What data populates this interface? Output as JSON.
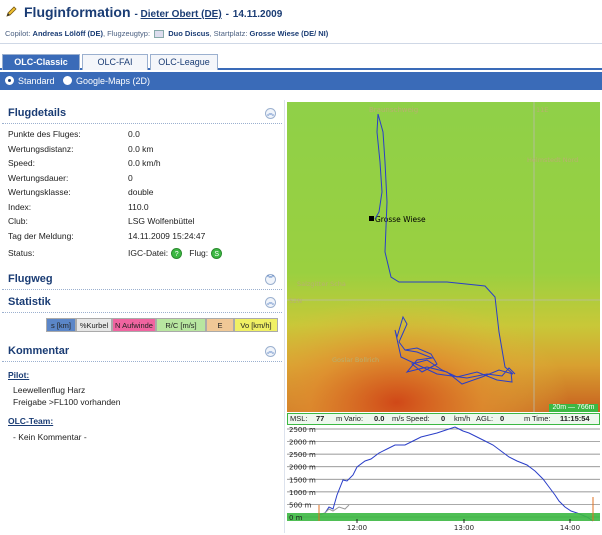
{
  "header": {
    "title": "Fluginformation",
    "pilot": "Dieter Obert (DE)",
    "separator": "-",
    "date": "14.11.2009",
    "copilot_label": "Copilot:",
    "copilot": "Andreas Lölöff (DE)",
    "plane_label": ", Flugzeugtyp:",
    "plane": "Duo Discus",
    "start_label": ", Startplatz:",
    "start": "Grosse Wiese (DE/ NI)"
  },
  "tabs": [
    {
      "label": "OLC-Classic",
      "active": true
    },
    {
      "label": "OLC-FAI",
      "active": false
    },
    {
      "label": "OLC-League",
      "active": false
    }
  ],
  "mode": {
    "standard": "Standard",
    "gmaps": "Google-Maps (2D)",
    "selected": "Standard"
  },
  "flugdetails": {
    "title": "Flugdetails",
    "rows": [
      {
        "k": "Punkte des Fluges:",
        "v": "0.0"
      },
      {
        "k": "Wertungsdistanz:",
        "v": "0.0 km"
      },
      {
        "k": "Speed:",
        "v": "0.0 km/h"
      },
      {
        "k": "Wertungsdauer:",
        "v": "0"
      },
      {
        "k": "Wertungsklasse:",
        "v": "double"
      },
      {
        "k": "Index:",
        "v": "110.0"
      },
      {
        "k": "Club:",
        "v": "LSG Wolfenbüttel"
      },
      {
        "k": "Tag der Meldung:",
        "v": "14.11.2009 15:24:47"
      }
    ],
    "status_label": "Status:",
    "igc_label": "IGC-Datei:",
    "flug_label": "Flug:",
    "igc_mark": "?",
    "flug_mark": "S"
  },
  "flugweg": {
    "title": "Flugweg"
  },
  "statistik": {
    "title": "Statistik",
    "buttons": [
      {
        "label": "s [km]",
        "color": "#5b86c8"
      },
      {
        "label": "%Kurbel",
        "color": "#e6e6e6"
      },
      {
        "label": "N Aufwinde",
        "color": "#f064a0"
      },
      {
        "label": "R/C [m/s]",
        "color": "#b8e6a0"
      },
      {
        "label": "E",
        "color": "#f0c896"
      },
      {
        "label": "Vo [km/h]",
        "color": "#f0f064"
      }
    ]
  },
  "kommentar": {
    "title": "Kommentar",
    "pilot_label": "Pilot:",
    "pilot_lines": [
      "Leewellenflug Harz",
      "Freigabe >FL100 vorhanden"
    ],
    "team_label": "OLC-Team:",
    "team_text": "- Kein Kommentar -"
  },
  "map": {
    "labels": [
      {
        "name": "Braunschweig"
      },
      {
        "name": "Helmstedt Nord"
      },
      {
        "name": "Grosse Wiese"
      },
      {
        "name": "Salzgitter Scha"
      },
      {
        "name": "Goslar Bollrich"
      },
      {
        "name": "52N"
      },
      {
        "name": "11E"
      }
    ],
    "scale": "20m — 766m"
  },
  "info": {
    "msl_label": "MSL:",
    "msl": "77",
    "msl_unit": "m",
    "vario_label": "Vario:",
    "vario": "0.0",
    "vario_unit": "m/s",
    "speed_label": "Speed:",
    "speed": "0",
    "speed_unit": "km/h",
    "agl_label": "AGL:",
    "agl": "0",
    "agl_unit": "m",
    "time_label": "Time:",
    "time": "11:15:54"
  },
  "profile": {
    "y_labels": [
      "2500 m",
      "2000 m",
      "2500 m",
      "2000 m",
      "1500 m",
      "1000 m",
      "500 m",
      "0 m"
    ],
    "x_labels": [
      "12:00",
      "13:00",
      "14:00"
    ]
  },
  "colors": {
    "brand": "#1a3c74",
    "accent": "#3a6bb8",
    "track": "#2a3ec8",
    "green": "#3cb843"
  }
}
